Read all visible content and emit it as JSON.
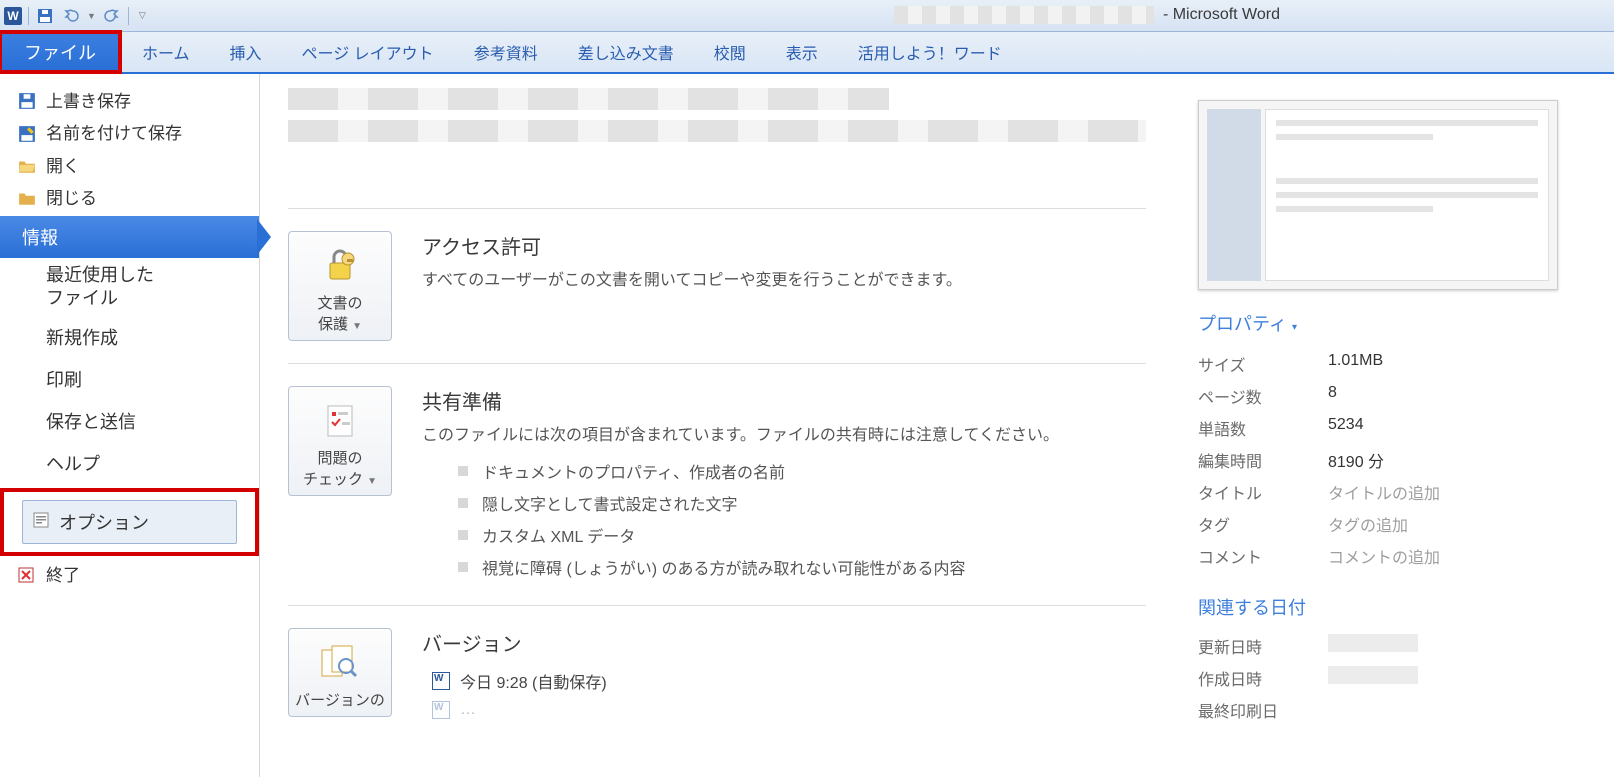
{
  "titlebar": {
    "app_suffix": " - Microsoft Word"
  },
  "tabs": {
    "file": "ファイル",
    "items": [
      "ホーム",
      "挿入",
      "ページ レイアウト",
      "参考資料",
      "差し込み文書",
      "校閲",
      "表示",
      "活用しよう！ワード"
    ]
  },
  "sidebar": {
    "save": "上書き保存",
    "save_as": "名前を付けて保存",
    "open": "開く",
    "close": "閉じる",
    "info": "情報",
    "recent_line1": "最近使用した",
    "recent_line2": "ファイル",
    "new": "新規作成",
    "print": "印刷",
    "share": "保存と送信",
    "help": "ヘルプ",
    "options": "オプション",
    "exit": "終了"
  },
  "center": {
    "permissions": {
      "button_line1": "文書の",
      "button_line2": "保護",
      "title": "アクセス許可",
      "desc": "すべてのユーザーがこの文書を開いてコピーや変更を行うことができます。"
    },
    "prepare": {
      "button_line1": "問題の",
      "button_line2": "チェック",
      "title": "共有準備",
      "desc": "このファイルには次の項目が含まれています。ファイルの共有時には注意してください。",
      "bullets": [
        "ドキュメントのプロパティ、作成者の名前",
        "隠し文字として書式設定された文字",
        "カスタム XML データ",
        "視覚に障碍 (しょうがい) のある方が読み取れない可能性がある内容"
      ]
    },
    "versions": {
      "button_line1": "バージョンの",
      "title": "バージョン",
      "items": [
        "今日 9:28 (自動保存)"
      ]
    }
  },
  "right": {
    "properties_header": "プロパティ",
    "rows": [
      {
        "label": "サイズ",
        "value": "1.01MB"
      },
      {
        "label": "ページ数",
        "value": "8"
      },
      {
        "label": "単語数",
        "value": "5234"
      },
      {
        "label": "編集時間",
        "value": "8190 分"
      },
      {
        "label": "タイトル",
        "value": "タイトルの追加",
        "placeholder": true
      },
      {
        "label": "タグ",
        "value": "タグの追加",
        "placeholder": true
      },
      {
        "label": "コメント",
        "value": "コメントの追加",
        "placeholder": true
      }
    ],
    "related_header": "関連する日付",
    "dates": [
      {
        "label": "更新日時"
      },
      {
        "label": "作成日時"
      },
      {
        "label": "最終印刷日"
      }
    ]
  }
}
